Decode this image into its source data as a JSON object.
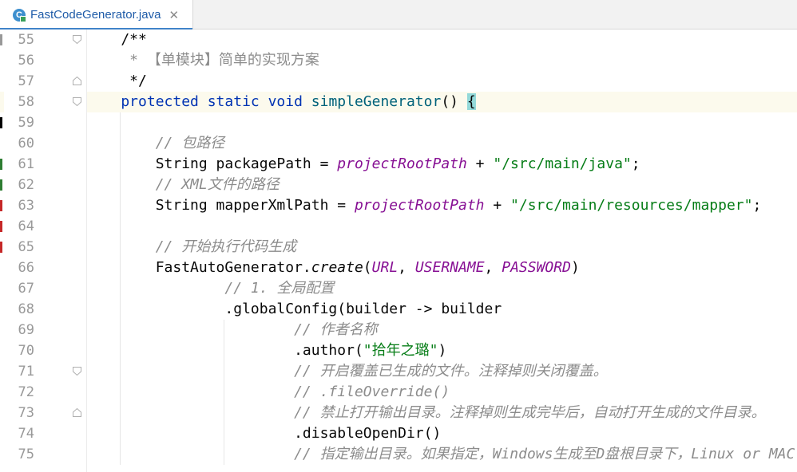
{
  "tab": {
    "icon": "C",
    "file_name": "FastCodeGenerator.java",
    "close": "✕"
  },
  "gutter_left_marks": [
    {
      "line": "55",
      "color": "#999999"
    },
    {
      "line": "59",
      "color": "#000000"
    },
    {
      "line": "61",
      "color": "#2e7d32"
    },
    {
      "line": "62",
      "color": "#2e7d32"
    },
    {
      "line": "63",
      "color": "#c62828"
    },
    {
      "line": "64",
      "color": "#c62828"
    },
    {
      "line": "65",
      "color": "#c62828"
    }
  ],
  "lines": [
    {
      "num": "55",
      "tokens": [
        {
          "c": "",
          "t": "    /**"
        }
      ]
    },
    {
      "num": "56",
      "tokens": [
        {
          "c": "cmt-plain",
          "t": "     * 【单模块】简单的实现方案"
        }
      ]
    },
    {
      "num": "57",
      "tokens": [
        {
          "c": "",
          "t": "     */"
        }
      ]
    },
    {
      "num": "58",
      "tokens": [
        {
          "c": "kw",
          "t": "    protected "
        },
        {
          "c": "kw",
          "t": "static "
        },
        {
          "c": "kw",
          "t": "void "
        },
        {
          "c": "fn",
          "t": "simpleGenerator"
        },
        {
          "c": "",
          "t": "() "
        },
        {
          "c": "brace-hl",
          "t": "{"
        }
      ]
    },
    {
      "num": "59",
      "tokens": [
        {
          "c": "",
          "t": ""
        }
      ]
    },
    {
      "num": "60",
      "tokens": [
        {
          "c": "cmt",
          "t": "        // 包路径"
        }
      ]
    },
    {
      "num": "61",
      "tokens": [
        {
          "c": "",
          "t": "        String packagePath = "
        },
        {
          "c": "fld",
          "t": "projectRootPath"
        },
        {
          "c": "",
          "t": " + "
        },
        {
          "c": "str",
          "t": "\"/src/main/java\""
        },
        {
          "c": "",
          "t": ";"
        }
      ]
    },
    {
      "num": "62",
      "tokens": [
        {
          "c": "cmt",
          "t": "        // XML文件的路径"
        }
      ]
    },
    {
      "num": "63",
      "tokens": [
        {
          "c": "",
          "t": "        String mapperXmlPath = "
        },
        {
          "c": "fld",
          "t": "projectRootPath"
        },
        {
          "c": "",
          "t": " + "
        },
        {
          "c": "str",
          "t": "\"/src/main/resources/mapper\""
        },
        {
          "c": "",
          "t": ";"
        }
      ]
    },
    {
      "num": "64",
      "tokens": [
        {
          "c": "",
          "t": ""
        }
      ]
    },
    {
      "num": "65",
      "tokens": [
        {
          "c": "cmt",
          "t": "        // 开始执行代码生成"
        }
      ]
    },
    {
      "num": "66",
      "tokens": [
        {
          "c": "",
          "t": "        FastAutoGenerator."
        },
        {
          "c": "mth",
          "t": "create"
        },
        {
          "c": "",
          "t": "("
        },
        {
          "c": "cst",
          "t": "URL"
        },
        {
          "c": "",
          "t": ", "
        },
        {
          "c": "cst",
          "t": "USERNAME"
        },
        {
          "c": "",
          "t": ", "
        },
        {
          "c": "cst",
          "t": "PASSWORD"
        },
        {
          "c": "",
          "t": ")"
        }
      ]
    },
    {
      "num": "67",
      "tokens": [
        {
          "c": "cmt",
          "t": "                // 1. 全局配置"
        }
      ]
    },
    {
      "num": "68",
      "tokens": [
        {
          "c": "",
          "t": "                .globalConfig(builder -> builder"
        }
      ]
    },
    {
      "num": "69",
      "tokens": [
        {
          "c": "cmt",
          "t": "                        // 作者名称"
        }
      ]
    },
    {
      "num": "70",
      "tokens": [
        {
          "c": "",
          "t": "                        .author("
        },
        {
          "c": "str",
          "t": "\"拾年之璐\""
        },
        {
          "c": "",
          "t": ")"
        }
      ]
    },
    {
      "num": "71",
      "tokens": [
        {
          "c": "cmt",
          "t": "                        // 开启覆盖已生成的文件。注释掉则关闭覆盖。"
        }
      ]
    },
    {
      "num": "72",
      "tokens": [
        {
          "c": "cmt",
          "t": "                        // .fileOverride()"
        }
      ]
    },
    {
      "num": "73",
      "tokens": [
        {
          "c": "cmt",
          "t": "                        // 禁止打开输出目录。注释掉则生成完毕后，自动打开生成的文件目录。"
        }
      ]
    },
    {
      "num": "74",
      "tokens": [
        {
          "c": "",
          "t": "                        .disableOpenDir()"
        }
      ]
    },
    {
      "num": "75",
      "tokens": [
        {
          "c": "cmt",
          "t": "                        // 指定输出目录。如果指定，Windows生成至D盘根目录下，Linux or MAC"
        }
      ]
    }
  ],
  "current_line": "58",
  "colors": {
    "keyword": "#0033b3",
    "string": "#067d17",
    "comment": "#8c8c8c",
    "field": "#871094",
    "method_decl": "#00627a",
    "tab_accent": "#4083c9",
    "current_line_bg": "#fcfaed",
    "brace_match_bg": "#93d9d9"
  }
}
